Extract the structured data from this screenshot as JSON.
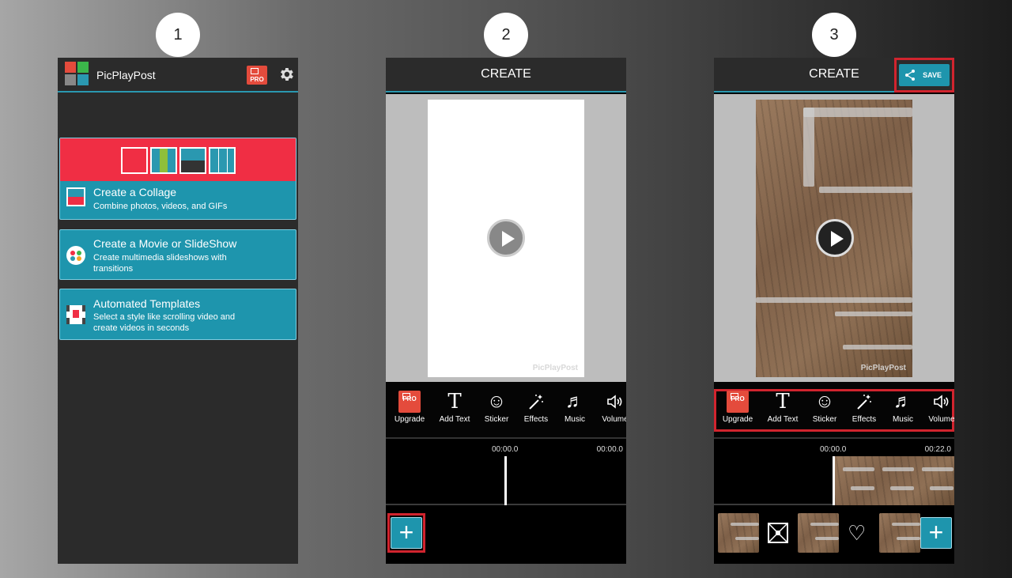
{
  "steps": [
    "1",
    "2",
    "3"
  ],
  "phone1": {
    "app_title": "PicPlayPost",
    "pro_label": "PRO",
    "cards": [
      {
        "title": "Create a Collage",
        "desc": "Combine photos, videos, and GIFs"
      },
      {
        "title": "Create a Movie or SlideShow",
        "desc_lines": [
          "Create multimedia slideshows with",
          "transitions"
        ]
      },
      {
        "title": "Automated Templates",
        "desc_lines": [
          "Select a style like scrolling video and",
          "create videos in seconds"
        ]
      }
    ],
    "colors": {
      "accent": "#1e95ad",
      "banner": "#f02e44",
      "header": "#2b2b2b"
    }
  },
  "phone2": {
    "header_title": "CREATE",
    "watermark": "PicPlayPost",
    "tools": [
      {
        "label": "Upgrade",
        "icon": "pro-icon"
      },
      {
        "label": "Add Text",
        "icon": "text-icon"
      },
      {
        "label": "Sticker",
        "icon": "sticker-icon"
      },
      {
        "label": "Effects",
        "icon": "magic-wand-icon"
      },
      {
        "label": "Music",
        "icon": "music-note-icon"
      },
      {
        "label": "Volume",
        "icon": "speaker-icon"
      }
    ],
    "time_start": "00:00.0",
    "time_end": "00:00.0",
    "add_label": "+"
  },
  "phone3": {
    "header_title": "CREATE",
    "save_label": "SAVE",
    "watermark": "PicPlayPost",
    "tools": [
      {
        "label": "Upgrade",
        "icon": "pro-icon"
      },
      {
        "label": "Add Text",
        "icon": "text-icon"
      },
      {
        "label": "Sticker",
        "icon": "sticker-icon"
      },
      {
        "label": "Effects",
        "icon": "magic-wand-icon"
      },
      {
        "label": "Music",
        "icon": "music-note-icon"
      },
      {
        "label": "Volume",
        "icon": "speaker-icon"
      }
    ],
    "time_start": "00:00.0",
    "time_end": "00:22.0",
    "add_label": "+"
  },
  "highlight_color": "#d1242e"
}
